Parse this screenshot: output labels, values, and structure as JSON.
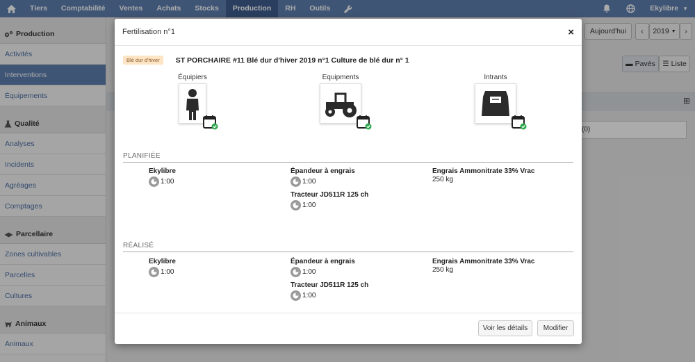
{
  "topnav": {
    "items": [
      {
        "label": "Tiers"
      },
      {
        "label": "Comptabilité"
      },
      {
        "label": "Ventes"
      },
      {
        "label": "Achats"
      },
      {
        "label": "Stocks"
      },
      {
        "label": "Production"
      },
      {
        "label": "RH"
      },
      {
        "label": "Outils"
      }
    ],
    "user_label": "Ekylibre",
    "accent": "#5e7fb0",
    "active_bg": "#3f5f8f"
  },
  "sidebar": {
    "sections": [
      {
        "title": "Production",
        "items": [
          "Activités",
          "Interventions",
          "Équipements"
        ]
      },
      {
        "title": "Qualité",
        "items": [
          "Analyses",
          "Incidents",
          "Agréages",
          "Comptages"
        ]
      },
      {
        "title": "Parcellaire",
        "items": [
          "Zones cultivables",
          "Parcelles",
          "Cultures"
        ]
      },
      {
        "title": "Animaux",
        "items": [
          "Animaux"
        ]
      }
    ]
  },
  "background": {
    "today_button": "Aujourd'hui",
    "year": "2019",
    "view_paves": "Pavés",
    "view_liste": "Liste",
    "row_count": "(0)"
  },
  "modal": {
    "title": "Fertilisation n°1",
    "crop_badge": "Blé dur d'hiver",
    "crop_title": "ST PORCHAIRE #11 Blé dur d'hiver 2019 n°1 Culture de blé dur n° 1",
    "resources": {
      "doers": "Équipiers",
      "tools": "Equipments",
      "inputs": "Intrants"
    },
    "planned": {
      "title": "PLANIFIÉE",
      "doer": {
        "name": "Ekylibre",
        "duration": "1:00"
      },
      "tools": [
        {
          "name": "Épandeur à engrais",
          "duration": "1:00"
        },
        {
          "name": "Tracteur JD511R 125 ch",
          "duration": "1:00"
        }
      ],
      "input": {
        "name": "Engrais Ammonitrate 33% Vrac",
        "quantity": "250 kg"
      }
    },
    "done": {
      "title": "RÉALISÉ",
      "doer": {
        "name": "Ekylibre",
        "duration": "1:00"
      },
      "tools": [
        {
          "name": "Épandeur à engrais",
          "duration": "1:00"
        },
        {
          "name": "Tracteur JD511R 125 ch",
          "duration": "1:00"
        }
      ],
      "input": {
        "name": "Engrais Ammonitrate 33% Vrac",
        "quantity": "250 kg"
      }
    },
    "footer": {
      "details_button": "Voir les détails",
      "edit_button": "Modifier"
    }
  }
}
